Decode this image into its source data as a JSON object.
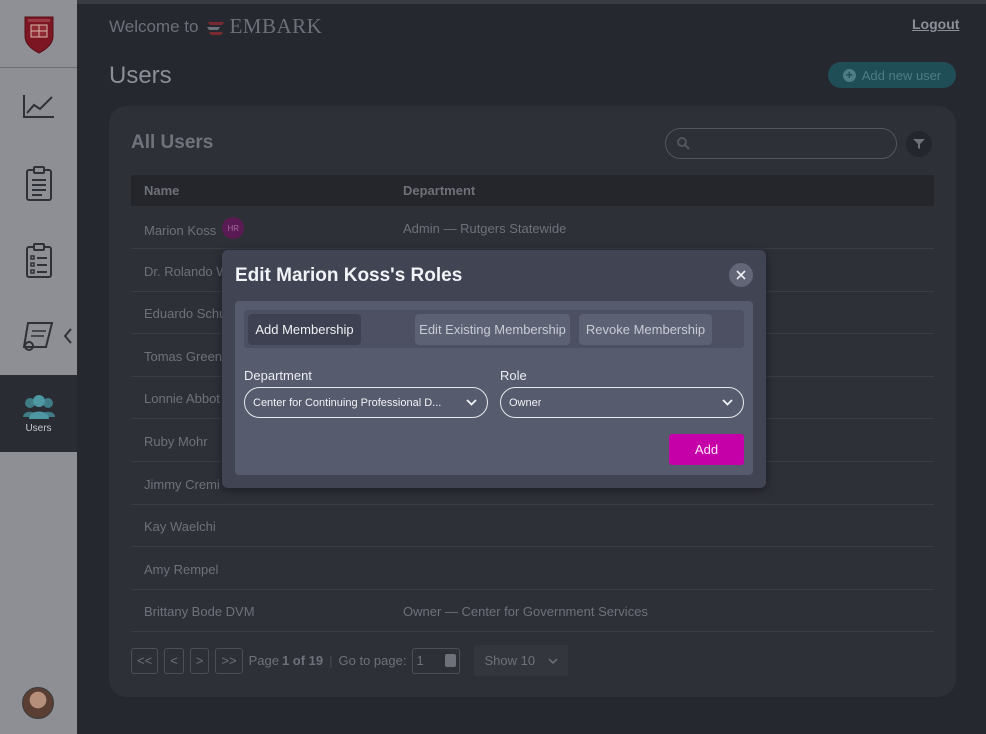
{
  "header": {
    "welcome_text": "Welcome to",
    "brand": "EMBARK",
    "logout": "Logout"
  },
  "sidebar": {
    "items": [
      {
        "icon": "chart-line-icon"
      },
      {
        "icon": "clipboard-icon"
      },
      {
        "icon": "checklist-icon"
      },
      {
        "icon": "scroll-diploma-icon"
      },
      {
        "icon": "users-icon",
        "label": "Users"
      }
    ]
  },
  "page": {
    "title": "Users",
    "add_user_label": "Add new user"
  },
  "users_table": {
    "title": "All Users",
    "search_placeholder": "Search",
    "columns": [
      "Name",
      "Department"
    ],
    "rows": [
      {
        "name": "Marion Koss",
        "badge": "HR",
        "department": "Admin — Rutgers Statewide"
      },
      {
        "name": "Dr. Rolando W",
        "badge": "",
        "department": ""
      },
      {
        "name": "Eduardo Schu",
        "badge": "",
        "department": ""
      },
      {
        "name": "Tomas Green",
        "badge": "",
        "department": ""
      },
      {
        "name": "Lonnie Abbot",
        "badge": "",
        "department": ""
      },
      {
        "name": "Ruby Mohr",
        "badge": "",
        "department": ""
      },
      {
        "name": "Jimmy Cremi",
        "badge": "",
        "department": ""
      },
      {
        "name": "Kay Waelchi",
        "badge": "",
        "department": ""
      },
      {
        "name": "Amy Rempel",
        "badge": "",
        "department": ""
      },
      {
        "name": "Brittany Bode DVM",
        "badge": "",
        "department": "Owner — Center for Government Services"
      }
    ]
  },
  "pagination": {
    "first": "<<",
    "prev": "<",
    "next": ">",
    "last": ">>",
    "page_prefix": "Page",
    "page_info": "1 of 19",
    "goto_label": "Go to page:",
    "goto_value": "1",
    "show_label": "Show 10"
  },
  "modal": {
    "title": "Edit Marion Koss's Roles",
    "tabs": [
      "Add Membership",
      "Edit Existing Membership",
      "Revoke Membership"
    ],
    "active_tab": "Add Membership",
    "department_label": "Department",
    "department_value": "Center for Continuing Professional D...",
    "role_label": "Role",
    "role_value": "Owner",
    "add_button": "Add"
  },
  "colors": {
    "accent_magenta": "#c500a8",
    "add_user_teal": "#1f4e56",
    "modal_bg": "#404453"
  }
}
